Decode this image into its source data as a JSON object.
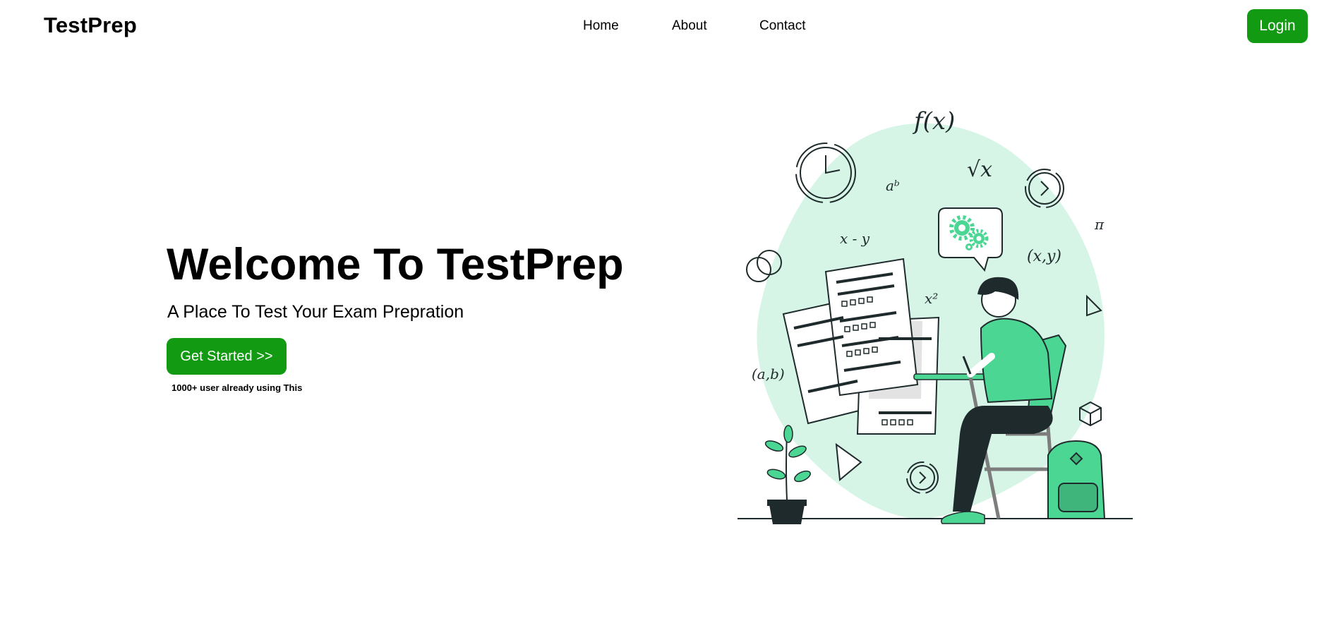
{
  "nav": {
    "brand": "TestPrep",
    "links": [
      "Home",
      "About",
      "Contact"
    ],
    "login_label": "Login"
  },
  "hero": {
    "title": "Welcome To TestPrep",
    "subtitle": "A Place To Test Your Exam Prepration",
    "cta_label": "Get Started >>",
    "user_note": "1000+ user already using This"
  },
  "illustration": {
    "math_symbols": [
      "f(x)",
      "√x",
      "aᵇ",
      "x - y",
      "x²",
      "(x,y)",
      "(a,b)",
      "π"
    ]
  },
  "colors": {
    "brand_green": "#129a12",
    "illustration_mint": "#d6f5e6",
    "illustration_green": "#4cd694",
    "illustration_dark": "#1f2a2c"
  }
}
